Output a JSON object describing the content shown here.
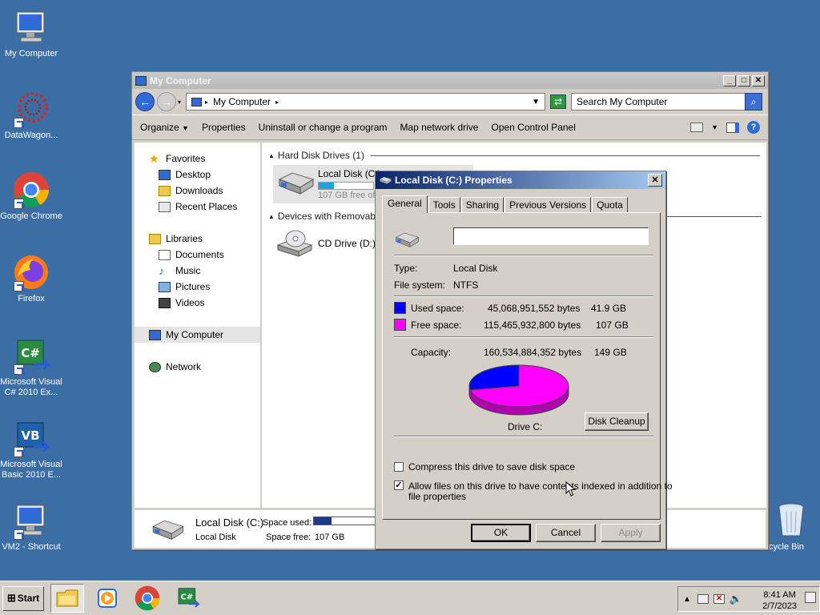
{
  "desktop": {
    "icons": [
      {
        "label": "My Computer"
      },
      {
        "label": "DataWagon..."
      },
      {
        "label": "Google Chrome"
      },
      {
        "label": "Firefox"
      },
      {
        "label": "Microsoft Visual C# 2010 Ex..."
      },
      {
        "label": "Microsoft Visual Basic 2010 E..."
      },
      {
        "label": "VM2 - Shortcut"
      },
      {
        "label": "cycle Bin"
      }
    ]
  },
  "explorer": {
    "title": "My Computer",
    "address": "My Computer",
    "search_placeholder": "Search My Computer",
    "commands": [
      "Organize",
      "Properties",
      "Uninstall or change a program",
      "Map network drive",
      "Open Control Panel"
    ],
    "nav": {
      "favorites": "Favorites",
      "favorites_items": [
        "Desktop",
        "Downloads",
        "Recent Places"
      ],
      "libraries": "Libraries",
      "libraries_items": [
        "Documents",
        "Music",
        "Pictures",
        "Videos"
      ],
      "my_computer": "My Computer",
      "network": "Network"
    },
    "groups": {
      "hard_disk": "Hard Disk Drives (1)",
      "removable": "Devices with Removable S"
    },
    "drive_c": {
      "name": "Local Disk (C:)",
      "free": "107 GB free of",
      "used_fraction": 0.28
    },
    "drive_d": {
      "name": "CD Drive (D:)"
    },
    "details": {
      "name": "Local Disk (C:)",
      "type": "Local Disk",
      "space_used_label": "Space used:",
      "space_free_label": "Space free:",
      "space_free_value": "107 GB",
      "used_fraction": 0.28
    }
  },
  "dialog": {
    "title": "Local Disk (C:) Properties",
    "tabs": [
      "General",
      "Tools",
      "Sharing",
      "Previous Versions",
      "Quota"
    ],
    "label_value": "",
    "type_label": "Type:",
    "type_value": "Local Disk",
    "fs_label": "File system:",
    "fs_value": "NTFS",
    "used_label": "Used space:",
    "used_bytes": "45,068,951,552 bytes",
    "used_gb": "41.9 GB",
    "free_label": "Free space:",
    "free_bytes": "115,465,932,800 bytes",
    "free_gb": "107 GB",
    "capacity_label": "Capacity:",
    "capacity_bytes": "160,534,884,352 bytes",
    "capacity_gb": "149 GB",
    "drive_label": "Drive C:",
    "cleanup_button": "Disk Cleanup",
    "compress_label": "Compress this drive to save disk space",
    "compress_checked": false,
    "index_label_1": "Allow files on this drive to have contents indexed in addition to",
    "index_label_2": "file properties",
    "index_checked": true,
    "ok_button": "OK",
    "cancel_button": "Cancel",
    "apply_button": "Apply",
    "used_color": "#0000ff",
    "free_color": "#ff00ff",
    "used_fraction": 0.2807
  },
  "taskbar": {
    "start_label": "Start",
    "time": "8:41 AM",
    "date": "2/7/2023"
  }
}
